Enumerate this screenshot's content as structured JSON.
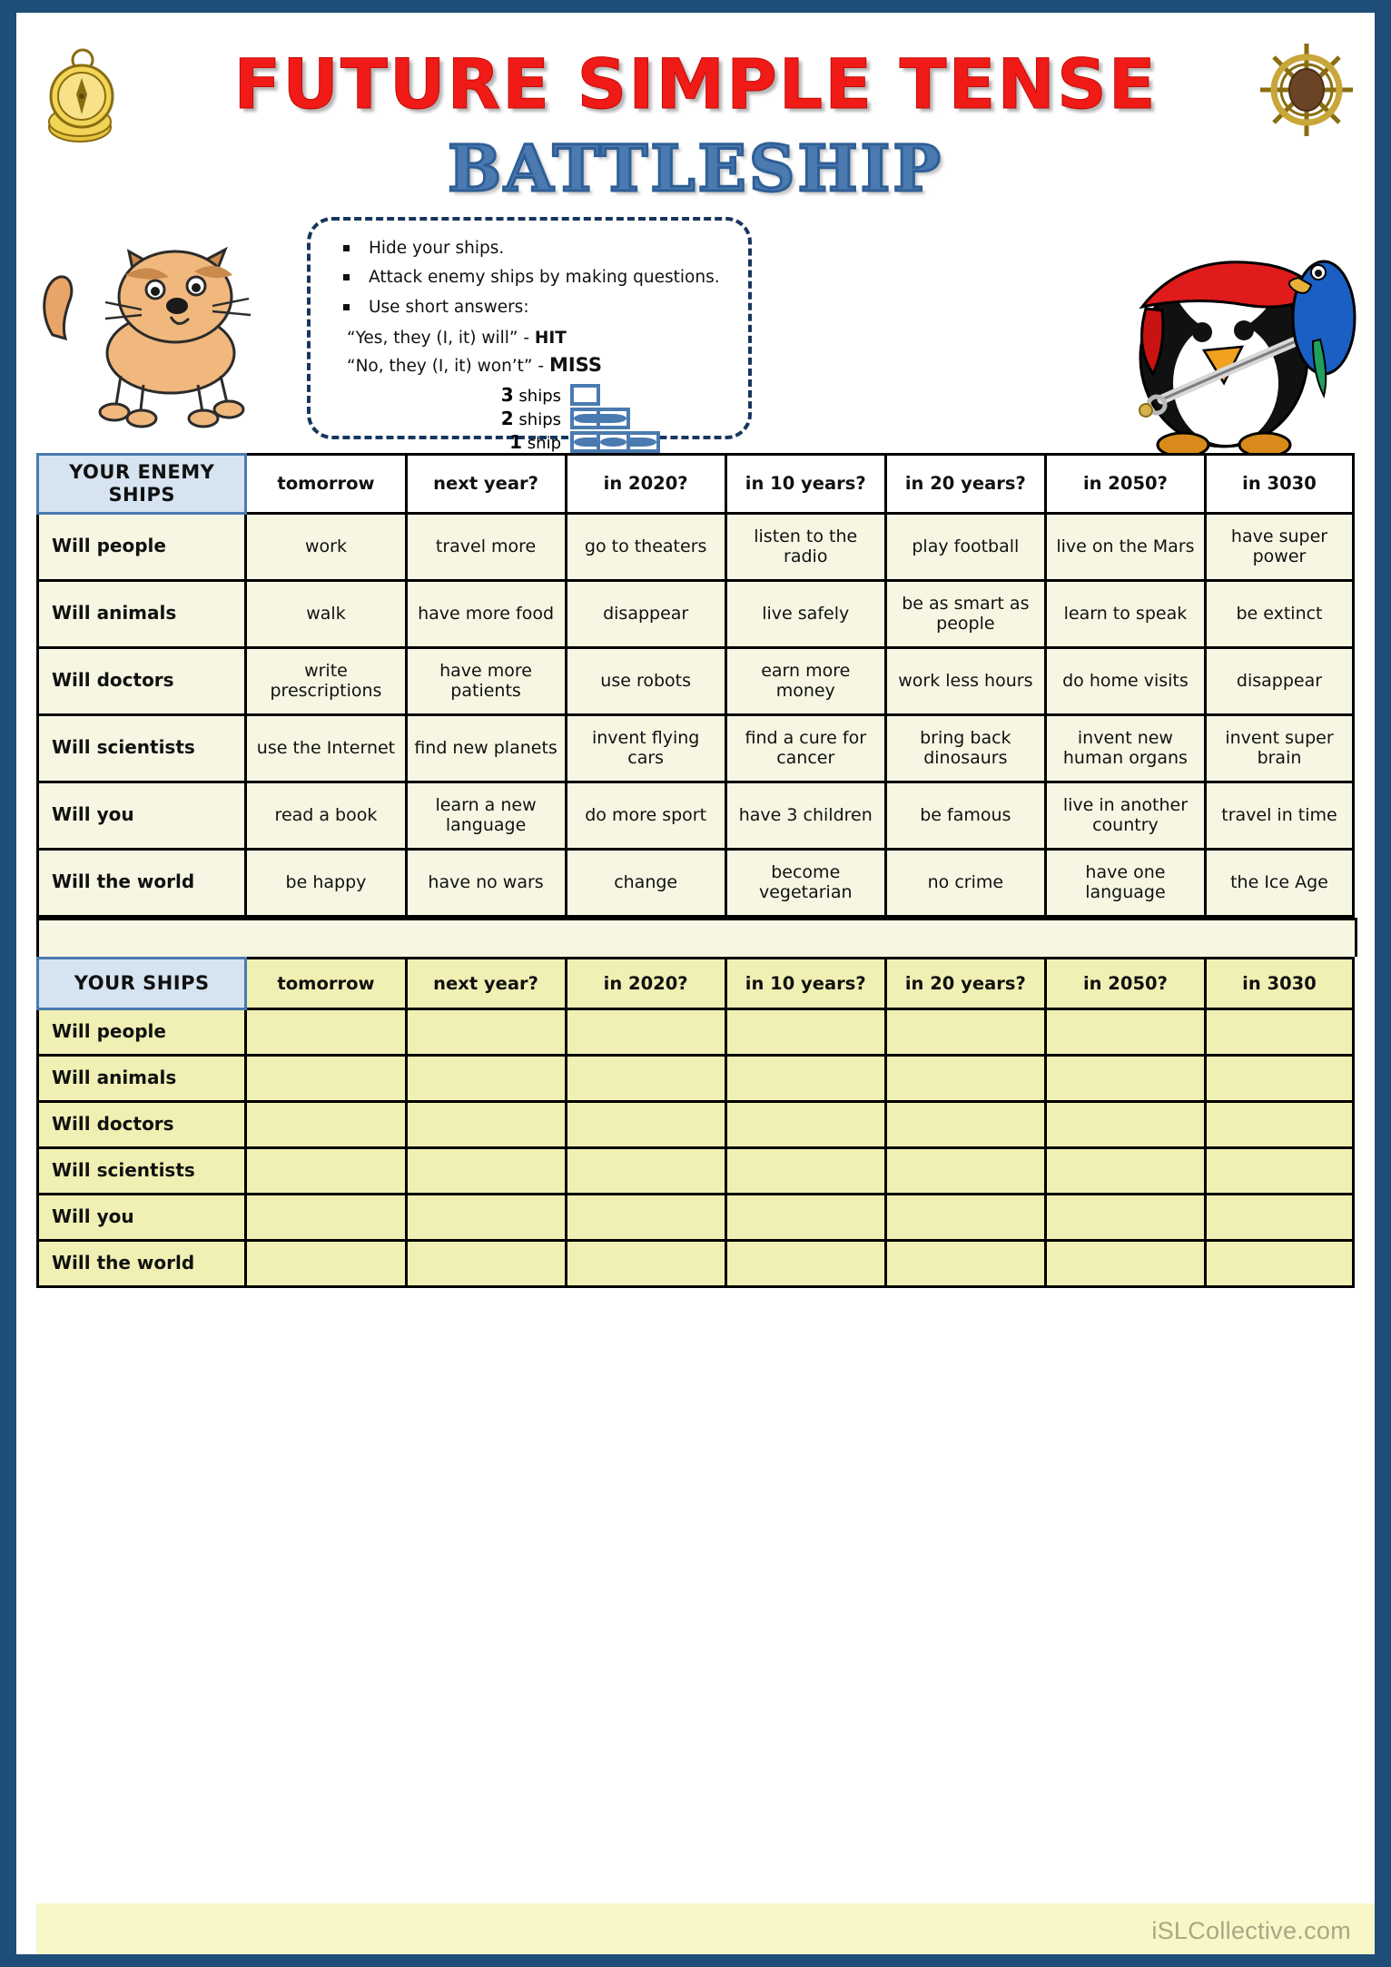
{
  "title": {
    "main": "FUTURE SIMPLE TENSE",
    "sub": "BATTLESHIP",
    "main_color": "#f01a16",
    "sub_color": "#4a7ab0"
  },
  "instructions": {
    "bullets": [
      "Hide your ships.",
      "Attack enemy ships by making questions.",
      "Use short answers:"
    ],
    "answer_hit": "“Yes, they (I, it) will” - ",
    "answer_hit_label": "HIT",
    "answer_miss": "“No, they (I, it) won’t” - ",
    "answer_miss_label": "MISS",
    "legend": [
      {
        "count": "3",
        "word": "ships",
        "cells": 1
      },
      {
        "count": "2",
        "word": "ships",
        "cells": 2
      },
      {
        "count": "1",
        "word": "ship",
        "cells": 3
      }
    ]
  },
  "enemy_table": {
    "corner_label": "YOUR ENEMY SHIPS",
    "columns": [
      "tomorrow",
      "next year?",
      "in 2020?",
      "in 10 years?",
      "in 20 years?",
      "in 2050?",
      "in 3030"
    ],
    "rows": [
      {
        "label": "Will people",
        "cells": [
          "work",
          "travel more",
          "go to theaters",
          "listen to the radio",
          "play football",
          "live on the Mars",
          "have super power"
        ]
      },
      {
        "label": "Will animals",
        "cells": [
          "walk",
          "have more food",
          "disappear",
          "live safely",
          "be as smart as people",
          "learn to speak",
          "be extinct"
        ]
      },
      {
        "label": "Will doctors",
        "cells": [
          "write prescriptions",
          "have more patients",
          "use robots",
          "earn more money",
          "work less hours",
          "do home visits",
          "disappear"
        ]
      },
      {
        "label": "Will scientists",
        "cells": [
          "use the Internet",
          "find new planets",
          "invent flying cars",
          "find a cure for cancer",
          "bring back dinosaurs",
          "invent new human organs",
          "invent super brain"
        ]
      },
      {
        "label": "Will you",
        "cells": [
          "read a book",
          "learn a new language",
          "do more sport",
          "have 3 children",
          "be famous",
          "live in another country",
          "travel in time"
        ]
      },
      {
        "label": "Will the world",
        "cells": [
          "be happy",
          "have no wars",
          "change",
          "become vegetarian",
          "no crime",
          "have one language",
          "the Ice Age"
        ]
      }
    ]
  },
  "your_table": {
    "corner_label": "YOUR SHIPS",
    "columns": [
      "tomorrow",
      "next year?",
      "in 2020?",
      "in 10 years?",
      "in 20 years?",
      "in 2050?",
      "in 3030"
    ],
    "rows": [
      {
        "label": "Will people",
        "cells": [
          "",
          "",
          "",
          "",
          "",
          "",
          ""
        ]
      },
      {
        "label": "Will animals",
        "cells": [
          "",
          "",
          "",
          "",
          "",
          "",
          ""
        ]
      },
      {
        "label": "Will doctors",
        "cells": [
          "",
          "",
          "",
          "",
          "",
          "",
          ""
        ]
      },
      {
        "label": "Will scientists",
        "cells": [
          "",
          "",
          "",
          "",
          "",
          "",
          ""
        ]
      },
      {
        "label": "Will you",
        "cells": [
          "",
          "",
          "",
          "",
          "",
          "",
          ""
        ]
      },
      {
        "label": "Will the world",
        "cells": [
          "",
          "",
          "",
          "",
          "",
          "",
          ""
        ]
      }
    ]
  },
  "watermark": "iSLCollective.com"
}
